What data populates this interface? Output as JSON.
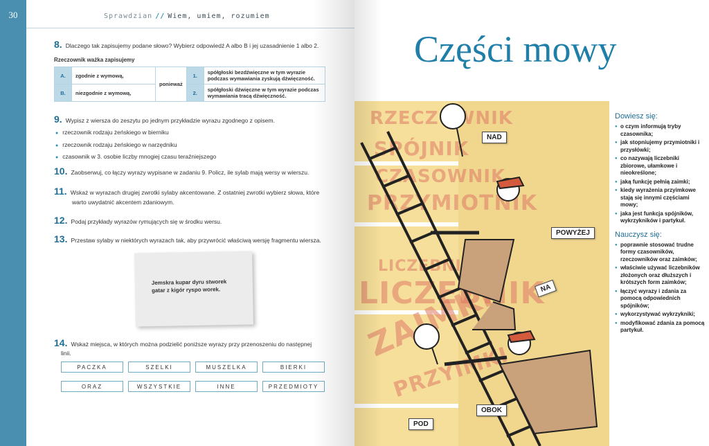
{
  "left_page": {
    "page_number": "30",
    "running_head": {
      "section": "Sprawdzian",
      "title": "Wiem, umiem, rozumiem"
    },
    "task8": {
      "number": "8.",
      "text": "Dlaczego tak zapisujemy podane słowo? Wybierz odpowiedź A albo B i jej uzasadnienie 1 albo 2.",
      "subhead": "Rzeczownik ważka zapisujemy",
      "rows": [
        {
          "letter": "A.",
          "answer": "zgodnie z wymową,",
          "digit": "1.",
          "reason": "spółgłoski bezdźwięczne w tym wyrazie podczas wymawiania zyskują dźwięczność."
        },
        {
          "letter": "B.",
          "answer": "niezgodnie z wymową,",
          "digit": "2.",
          "reason": "spółgłoski dźwięczne w tym wyrazie podczas wymawiania tracą dźwięczność."
        }
      ],
      "connector": "ponieważ"
    },
    "task9": {
      "number": "9.",
      "text": "Wypisz z wiersza do zeszytu po jednym przykładzie wyrazu zgodnego z opisem.",
      "bullets": [
        "rzeczownik rodzaju żeńskiego w bierniku",
        "rzeczownik rodzaju żeńskiego w narzędniku",
        "czasownik w 3. osobie liczby mnogiej czasu teraźniejszego"
      ]
    },
    "task10": {
      "number": "10.",
      "text": "Zaobserwuj, co łączy wyrazy wypisane w zadaniu 9. Policz, ile sylab mają wersy w wierszu."
    },
    "task11": {
      "number": "11.",
      "line1": "Wskaż w wyrazach drugiej zwrotki sylaby akcentowane. Z ostatniej zwrotki wybierz słowa, które",
      "line2": "warto uwydatnić akcentem zdaniowym."
    },
    "task12": {
      "number": "12.",
      "text": "Podaj przykłady wyrazów rymujących się w środku wersu."
    },
    "task13": {
      "number": "13.",
      "text": "Przestaw sylaby w niektórych wyrazach tak, aby przywrócić właściwą wersję fragmentu wiersza."
    },
    "note": "Jemskra kupar dyru stworek\ngatar z kigór ryspo worek.",
    "task14": {
      "number": "14.",
      "line1": "Wskaż miejsca, w których można podzielić poniższe wyrazy przy przenoszeniu do następnej",
      "line2": "linii.",
      "words": [
        "PACZKA",
        "SZELKI",
        "MUSZELKA",
        "BIERKI",
        "ORAZ",
        "WSZYSTKIE",
        "INNE",
        "PRZEDMIOTY"
      ]
    }
  },
  "right_page": {
    "title": "Części mowy",
    "illustration": {
      "bg_words": [
        "RZECZOWNIK",
        "SPÓJNIK",
        "CZASOWNIK",
        "PRZYMIOTNIK",
        "LICZEBNIK",
        "LICZEBNIK",
        "ZAIMKI",
        "PRZYIMKI"
      ],
      "tags": [
        "NAD",
        "POWYŻEJ",
        "NA",
        "OBOK",
        "POD"
      ]
    },
    "learn": {
      "heading": "Dowiesz się:",
      "items": [
        "o czym informują tryby czasownika;",
        "jak stopniujemy przymiotniki i przysłówki;",
        "co nazywają liczebniki zbiorowe, ułamkowe i nieokreślone;",
        "jaką funkcję pełnią zaimki;",
        "kiedy wyrażenia przyimkowe stają się innymi częściami mowy;",
        "jaka jest funkcja spójników, wykrzykników i partykuł."
      ]
    },
    "skills": {
      "heading": "Nauczysz się:",
      "items": [
        "poprawnie stosować trudne formy czasowników, rzeczowników oraz zaimków;",
        "właściwie używać liczebników złożonych oraz dłuższych i krótszych form zaimków;",
        "łączyć wyrazy i zdania za pomocą odpowiednich spójników;",
        "wykorzystywać wykrzykniki;",
        "modyfikować zdania za pomocą partykuł."
      ]
    },
    "colors": {
      "accent": "#1f7fa8",
      "strip": "#4a8fb0",
      "illustration_bg": "#f6df9a",
      "bg_word": "#dc7864"
    }
  }
}
